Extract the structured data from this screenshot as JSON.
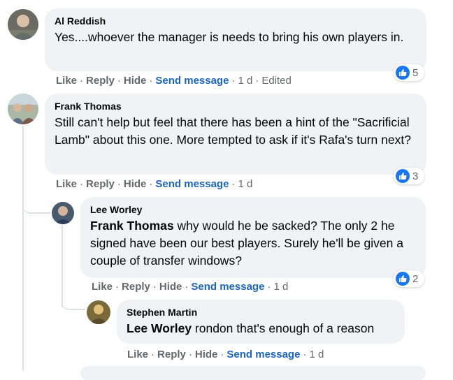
{
  "comments": [
    {
      "author": "Al Reddish",
      "text": "Yes....whoever the manager is needs to bring his own players in.",
      "actions": {
        "like": "Like",
        "reply": "Reply",
        "hide": "Hide",
        "send": "Send message",
        "time": "1 d",
        "edited": "Edited"
      },
      "reactions": "5"
    },
    {
      "author": "Frank Thomas",
      "text": "Still can't help but feel that there has been a hint of the \"Sacrificial Lamb\" about this one. More tempted to ask if it's Rafa's turn next?",
      "actions": {
        "like": "Like",
        "reply": "Reply",
        "hide": "Hide",
        "send": "Send message",
        "time": "1 d"
      },
      "reactions": "3"
    },
    {
      "author": "Lee Worley",
      "mention": "Frank Thomas",
      "text": " why would he be sacked? The only 2 he signed have been our best players. Surely he'll be given a couple of transfer windows?",
      "actions": {
        "like": "Like",
        "reply": "Reply",
        "hide": "Hide",
        "send": "Send message",
        "time": "1 d"
      },
      "reactions": "2"
    },
    {
      "author": "Stephen Martin",
      "mention": "Lee Worley",
      "text": " rondon that's enough of a reason",
      "actions": {
        "like": "Like",
        "reply": "Reply",
        "hide": "Hide",
        "send": "Send message",
        "time": "1 d"
      }
    }
  ],
  "separator": "·",
  "colors": {
    "bubble": "#f0f2f5",
    "link": "#1a65c4",
    "meta": "#65676b",
    "like_blue": "#1877f2"
  }
}
